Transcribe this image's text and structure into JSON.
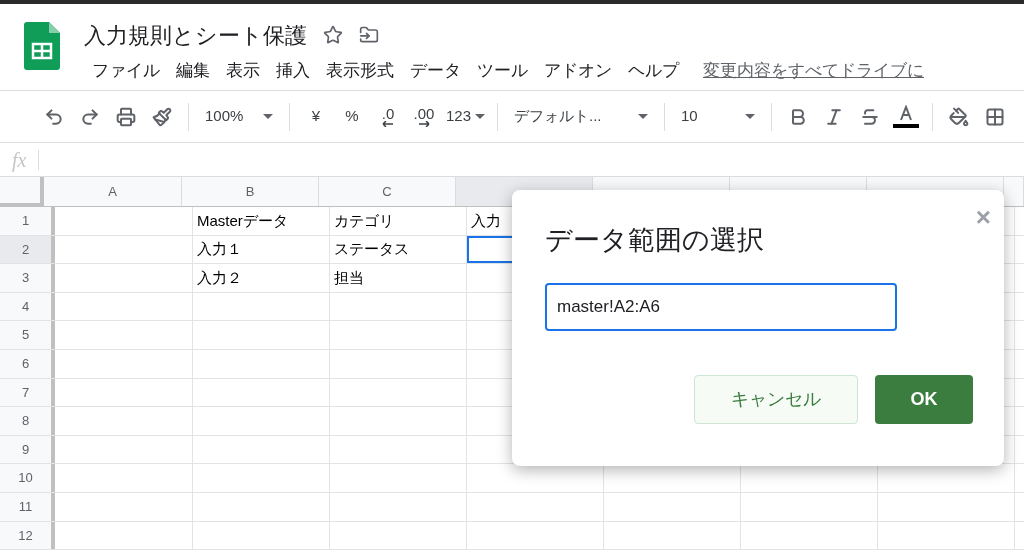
{
  "document": {
    "title": "入力規則とシート保護",
    "starred": false
  },
  "menu": [
    "ファイル",
    "編集",
    "表示",
    "挿入",
    "表示形式",
    "データ",
    "ツール",
    "アドオン",
    "ヘルプ"
  ],
  "save_status": "変更内容をすべてドライブに",
  "toolbar": [
    {
      "kind": "icon"
    },
    {
      "kind": "icon"
    },
    {
      "kind": "icon"
    },
    {
      "kind": "icon"
    },
    {
      "kind": "sep"
    },
    {
      "kind": "dropdown",
      "label": "100%"
    },
    {
      "kind": "sep"
    },
    {
      "kind": "text",
      "label": "¥"
    },
    {
      "kind": "text",
      "label": "%"
    },
    {
      "kind": "decimal",
      "label": ".0"
    },
    {
      "kind": "decimal",
      "label": ".00"
    },
    {
      "kind": "caret-text",
      "label": "123"
    },
    {
      "kind": "sep"
    },
    {
      "kind": "dropdown",
      "label": "デフォルト..."
    },
    {
      "kind": "sep"
    },
    {
      "kind": "dropdown",
      "label": "10"
    },
    {
      "kind": "sep"
    },
    {
      "kind": "icon"
    },
    {
      "kind": "icon"
    },
    {
      "kind": "icon"
    },
    {
      "kind": "icon"
    },
    {
      "kind": "sep"
    },
    {
      "kind": "icon"
    },
    {
      "kind": "icon"
    }
  ],
  "formula_bar": {
    "label": "fx"
  },
  "columns": [
    "A",
    "B",
    "C"
  ],
  "rows": [
    {
      "number": "1",
      "selected": false,
      "b": "Masterデータ",
      "c": "カテゴリ",
      "d": "入力"
    },
    {
      "number": "2",
      "selected": true,
      "b": "入力１",
      "c": "ステータス"
    },
    {
      "number": "3",
      "selected": false,
      "b": "入力２",
      "c": "担当"
    },
    {
      "number": "4",
      "selected": false
    },
    {
      "number": "5",
      "selected": false
    },
    {
      "number": "6",
      "selected": false
    },
    {
      "number": "7",
      "selected": false
    },
    {
      "number": "8",
      "selected": false
    },
    {
      "number": "9",
      "selected": false
    },
    {
      "number": "10",
      "selected": false
    },
    {
      "number": "11",
      "selected": false
    },
    {
      "number": "12",
      "selected": false
    }
  ],
  "dialog": {
    "title": "データ範囲の選択",
    "close": "×",
    "range_value": "master!A2:A6",
    "buttons": [
      {
        "label": "キャンセル",
        "kind": "secondary"
      },
      {
        "label": "OK",
        "kind": "primary"
      }
    ]
  }
}
